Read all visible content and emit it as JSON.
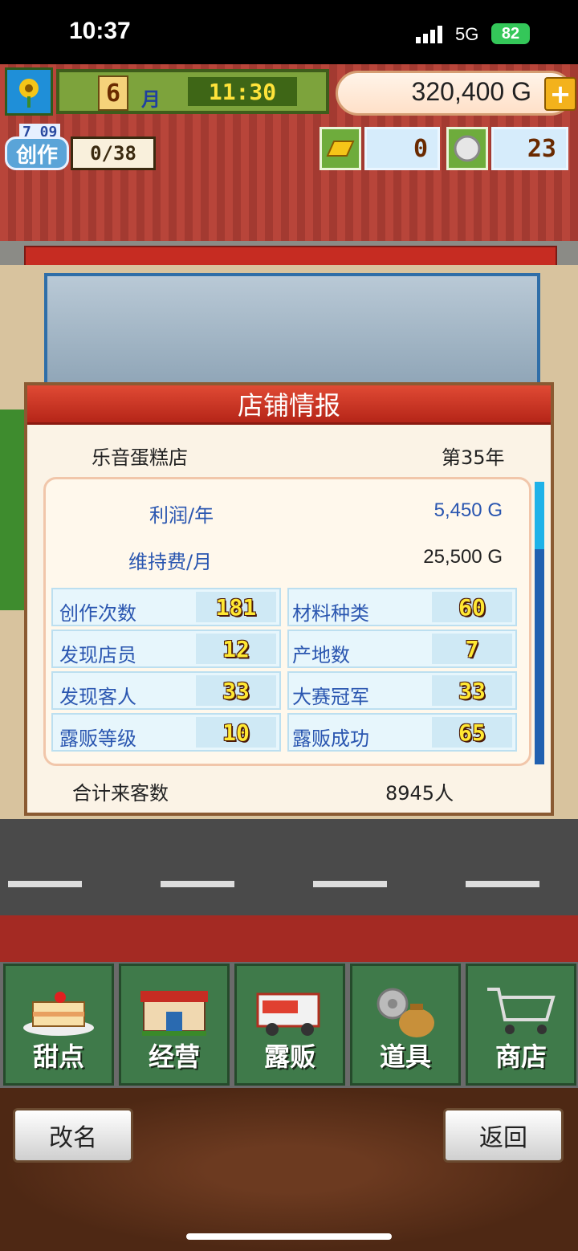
{
  "status_bar": {
    "time": "10:37",
    "network": "5G",
    "battery": "82"
  },
  "hud": {
    "month": "6",
    "month_label": "月",
    "time": "11:30",
    "gold": "320,400 G",
    "create_date": "7 09",
    "create_label": "创作",
    "create_progress": "0/38",
    "resource1": "0",
    "resource2": "23"
  },
  "dialog": {
    "title": "店铺情报",
    "shop_name": "乐音蛋糕店",
    "year": "第35年",
    "profit_label": "利润/年",
    "profit_value": "5,450 G",
    "upkeep_label": "维持费/月",
    "upkeep_value": "25,500 G",
    "stats": [
      {
        "label": "创作次数",
        "value": "181"
      },
      {
        "label": "材料种类",
        "value": "60"
      },
      {
        "label": "发现店员",
        "value": "12"
      },
      {
        "label": "产地数",
        "value": "7"
      },
      {
        "label": "发现客人",
        "value": "33"
      },
      {
        "label": "大赛冠军",
        "value": "33"
      },
      {
        "label": "露贩等级",
        "value": "10"
      },
      {
        "label": "露贩成功",
        "value": "65"
      }
    ],
    "total_label": "合计来客数",
    "total_value": "8945人"
  },
  "nav": [
    {
      "label": "甜点",
      "icon": "cake-icon"
    },
    {
      "label": "经营",
      "icon": "shop-building-icon"
    },
    {
      "label": "露贩",
      "icon": "food-truck-icon"
    },
    {
      "label": "道具",
      "icon": "gear-sack-icon"
    },
    {
      "label": "商店",
      "icon": "shopping-cart-icon"
    }
  ],
  "buttons": {
    "rename": "改名",
    "back": "返回"
  },
  "colors": {
    "accent_red": "#c62c22",
    "nav_green": "#3f7a4a",
    "label_blue": "#2a56b0"
  }
}
